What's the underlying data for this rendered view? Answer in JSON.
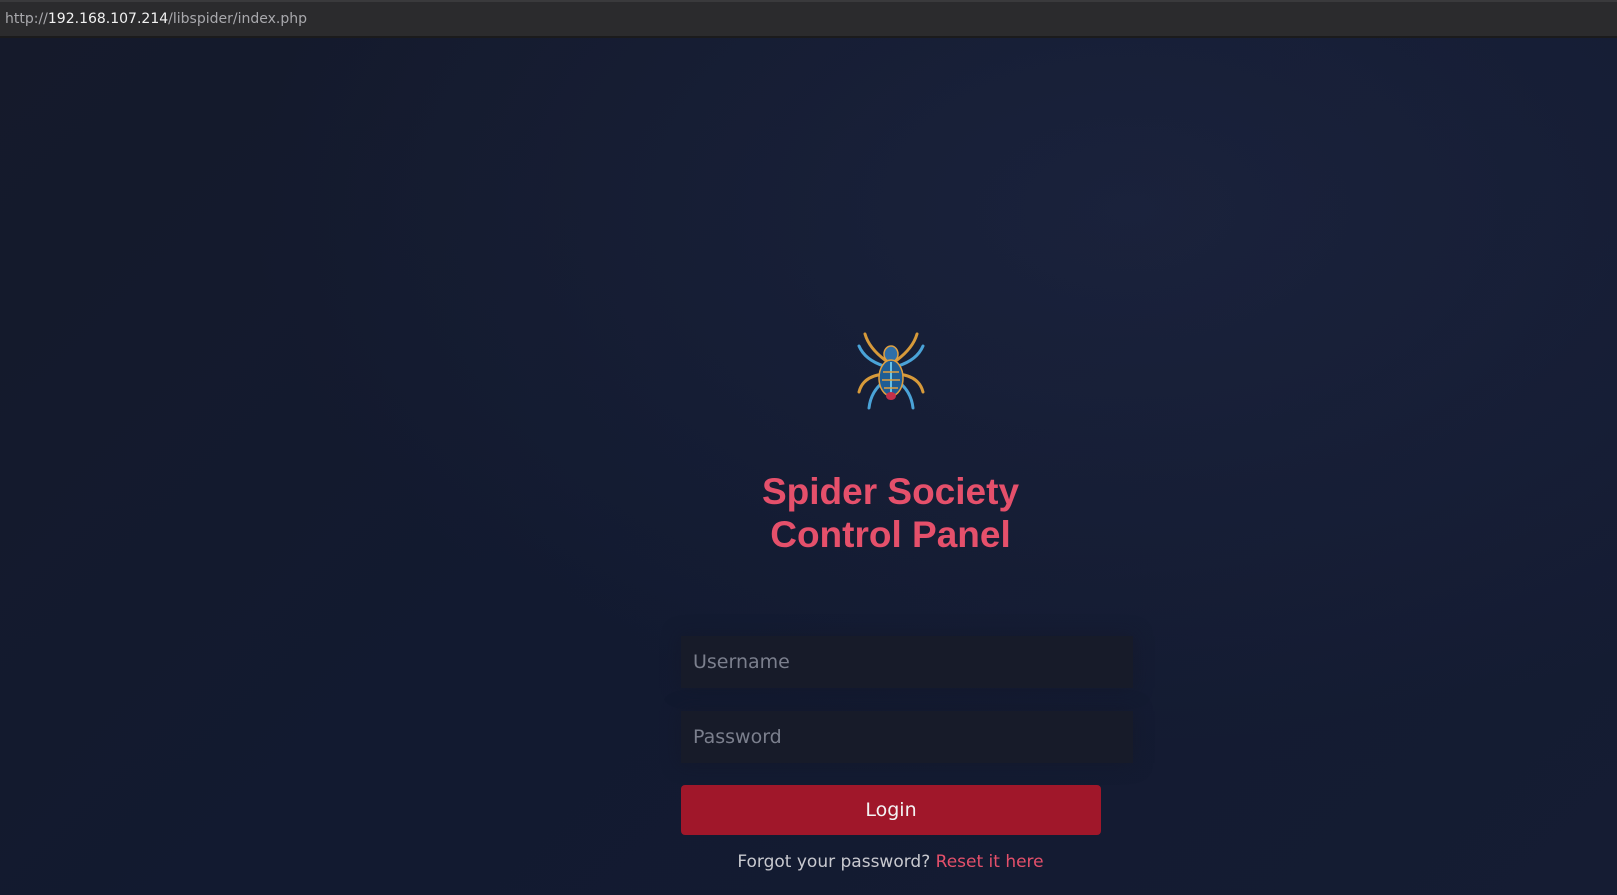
{
  "browser": {
    "url_scheme": "http://",
    "url_host": "192.168.107.214",
    "url_path": "/libspider/index.php"
  },
  "logo": {
    "icon": "spider-icon"
  },
  "login": {
    "title_line1": "Spider Society",
    "title_line2": "Control Panel",
    "username_placeholder": "Username",
    "password_placeholder": "Password",
    "login_label": "Login",
    "forgot_text": "Forgot your password?",
    "reset_link": "Reset it here"
  },
  "colors": {
    "background": "#141a2c",
    "accent": "#e5506b",
    "button": "#a0172a"
  }
}
